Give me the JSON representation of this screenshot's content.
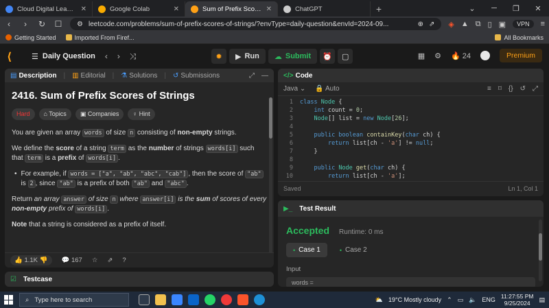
{
  "browser": {
    "tabs": [
      {
        "label": "Cloud Digital Leader Certification - ",
        "color": "#4285f4",
        "active": false
      },
      {
        "label": "Google Colab",
        "color": "#f9ab00",
        "active": false
      },
      {
        "label": "Sum of Prefix Scores of Strings",
        "color": "#ffa116",
        "active": true
      },
      {
        "label": "ChatGPT",
        "color": "#cccccc",
        "active": false
      }
    ],
    "url": "leetcode.com/problems/sum-of-prefix-scores-of-strings/?envType=daily-question&envId=2024-09...",
    "vpn": "VPN",
    "bookmarks": [
      "Getting Started",
      "Imported From Firef..."
    ],
    "all_bookmarks": "All Bookmarks"
  },
  "nav": {
    "daily": "Daily Question",
    "run": "Run",
    "submit": "Submit",
    "streak": "24",
    "premium": "Premium"
  },
  "desc": {
    "tabs": [
      "Description",
      "Editorial",
      "Solutions",
      "Submissions"
    ],
    "title": "2416. Sum of Prefix Scores of Strings",
    "tags": [
      "Hard",
      "Topics",
      "Companies",
      "Hint"
    ],
    "p1": [
      "You are given an array ",
      "words",
      " of size ",
      "n",
      " consisting of ",
      "non-empty",
      " strings."
    ],
    "p2": [
      "We define the ",
      "score",
      " of a string ",
      "term",
      " as the ",
      "number",
      " of strings ",
      "words[i]",
      " such that ",
      "term",
      " is a ",
      "prefix",
      " of ",
      "words[i]",
      "."
    ],
    "p3": [
      "For example, if ",
      "words = [\"a\", \"ab\", \"abc\", \"cab\"]",
      ", then the score of ",
      "\"ab\"",
      " is ",
      "2",
      ", since ",
      "\"ab\"",
      " is a prefix of both ",
      "\"ab\"",
      " and ",
      "\"abc\"",
      "."
    ],
    "p4": [
      "Return ",
      "an array ",
      "answer",
      " of size ",
      "n",
      " where ",
      "answer[i]",
      " is the ",
      "sum",
      " of scores of every ",
      "non-empty",
      " prefix of ",
      "words[i]",
      "."
    ],
    "p5": [
      "Note",
      " that a string is considered as a prefix of itself."
    ],
    "likes": "1.1K",
    "comments": "167"
  },
  "testcase": {
    "label": "Testcase"
  },
  "code": {
    "label": "Code",
    "lang": "Java",
    "auto": "Auto",
    "status": "Saved",
    "pos": "Ln 1, Col 1",
    "lines": [
      {
        "n": "1",
        "t": [
          [
            "kw",
            "class "
          ],
          [
            "ty",
            "Node"
          ],
          [
            "tx",
            " {"
          ]
        ]
      },
      {
        "n": "2",
        "t": [
          [
            "tx",
            "    "
          ],
          [
            "kw",
            "int "
          ],
          [
            "tx",
            "count = "
          ],
          [
            "nm",
            "0"
          ],
          [
            "tx",
            ";"
          ]
        ]
      },
      {
        "n": "3",
        "t": [
          [
            "tx",
            "    "
          ],
          [
            "ty",
            "Node"
          ],
          [
            "tx",
            "[] list = "
          ],
          [
            "kw",
            "new "
          ],
          [
            "ty",
            "Node"
          ],
          [
            "tx",
            "["
          ],
          [
            "nm",
            "26"
          ],
          [
            "tx",
            "];"
          ]
        ]
      },
      {
        "n": "4",
        "t": [
          [
            "tx",
            ""
          ]
        ]
      },
      {
        "n": "5",
        "t": [
          [
            "tx",
            "    "
          ],
          [
            "kw",
            "public boolean "
          ],
          [
            "fn",
            "containKey"
          ],
          [
            "tx",
            "("
          ],
          [
            "kw",
            "char "
          ],
          [
            "tx",
            "ch) {"
          ]
        ]
      },
      {
        "n": "6",
        "t": [
          [
            "tx",
            "        "
          ],
          [
            "kw",
            "return "
          ],
          [
            "tx",
            "list[ch - "
          ],
          [
            "st",
            "'a'"
          ],
          [
            "tx",
            "] != "
          ],
          [
            "kw",
            "null"
          ],
          [
            "tx",
            ";"
          ]
        ]
      },
      {
        "n": "7",
        "t": [
          [
            "tx",
            "    }"
          ]
        ]
      },
      {
        "n": "8",
        "t": [
          [
            "tx",
            ""
          ]
        ]
      },
      {
        "n": "9",
        "t": [
          [
            "tx",
            "    "
          ],
          [
            "kw",
            "public "
          ],
          [
            "ty",
            "Node "
          ],
          [
            "fn",
            "get"
          ],
          [
            "tx",
            "("
          ],
          [
            "kw",
            "char "
          ],
          [
            "tx",
            "ch) {"
          ]
        ]
      },
      {
        "n": "10",
        "t": [
          [
            "tx",
            "        "
          ],
          [
            "kw",
            "return "
          ],
          [
            "tx",
            "list[ch - "
          ],
          [
            "st",
            "'a'"
          ],
          [
            "tx",
            "];"
          ]
        ]
      }
    ]
  },
  "result": {
    "label": "Test Result",
    "status": "Accepted",
    "runtime": "Runtime: 0 ms",
    "case1": "Case 1",
    "case2": "Case 2",
    "input": "Input",
    "input_value": "words ="
  },
  "taskbar": {
    "search": "Type here to search",
    "weather": "19°C  Mostly cloudy",
    "lang": "ENG",
    "time": "11:27:55 PM",
    "date": "9/25/2024"
  }
}
